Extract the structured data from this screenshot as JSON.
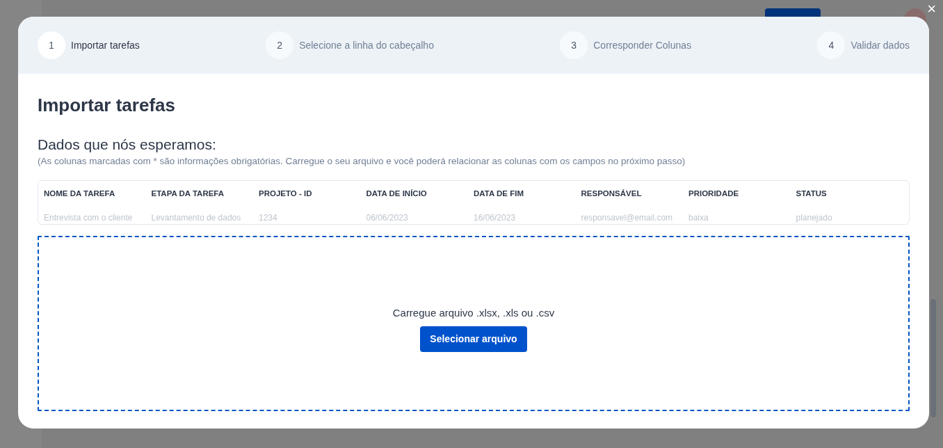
{
  "close_label": "×",
  "steps": [
    {
      "number": "1",
      "label": "Importar tarefas",
      "selected": true
    },
    {
      "number": "2",
      "label": "Selecione a linha do cabeçalho",
      "selected": false
    },
    {
      "number": "3",
      "label": "Corresponder Colunas",
      "selected": false
    },
    {
      "number": "4",
      "label": "Validar dados",
      "selected": false
    }
  ],
  "title": "Importar tarefas",
  "subtitle": "Dados que nós esperamos:",
  "note": "(As colunas marcadas com * são informações obrigatórias. Carregue o seu arquivo e você poderá relacionar as colunas com os campos no próximo passo)",
  "table": {
    "columns": [
      "NOME DA TAREFA",
      "ETAPA DA TAREFA",
      "PROJETO - ID",
      "DATA DE INÍCIO",
      "DATA DE FIM",
      "RESPONSÁVEL",
      "PRIORIDADE",
      "STATUS"
    ],
    "rows": [
      [
        "Entrevista com o cliente",
        "Levantamento de dados",
        "1234",
        "06/06/2023",
        "16/06/2023",
        "responsavel@email.com",
        "baixa",
        "planejado"
      ]
    ]
  },
  "dropzone": {
    "message": "Carregue arquivo .xlsx, .xls ou .csv",
    "button": "Selecionar arquivo"
  }
}
